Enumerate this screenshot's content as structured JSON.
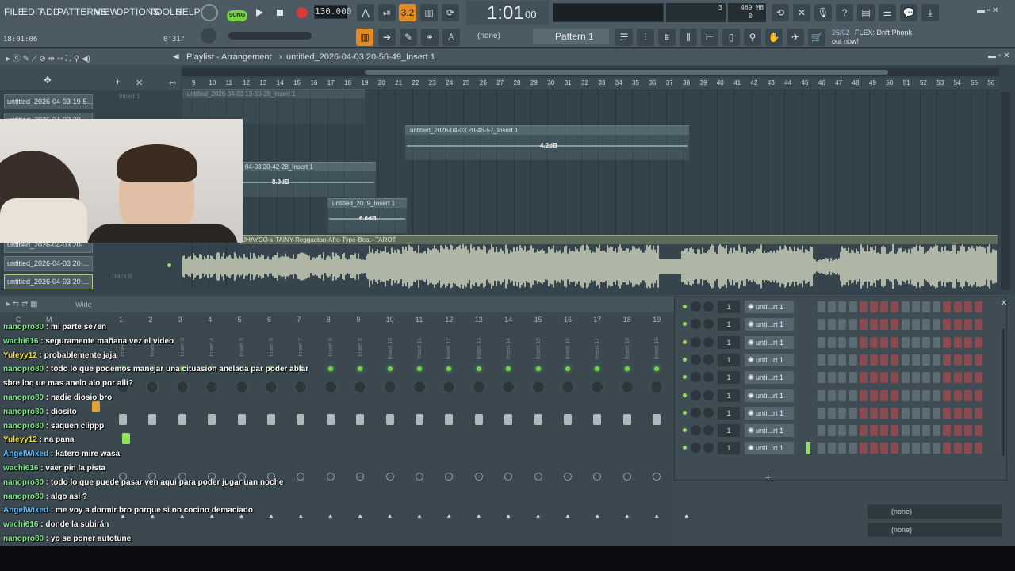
{
  "menu": [
    "FILE",
    "EDIT",
    "ADD",
    "PATTERNS",
    "VIEW",
    "OPTIONS",
    "TOOLS",
    "HELP"
  ],
  "transport": {
    "song_label": "SONG",
    "tempo": "130.000",
    "time": "1:01",
    "time_small": "00",
    "pattern_none": "(none)",
    "pattern": "Pattern 1",
    "cpu_top": "3",
    "mem": "469 MB",
    "mem_sub": "0",
    "hint_date": "26/02",
    "hint_text": "FLEX: Drift Phonk",
    "hint_sub": "out now!"
  },
  "status": {
    "time_left": "18:01:06",
    "duration": "0'31\""
  },
  "playlist": {
    "title": "Playlist - Arrangement",
    "breadcrumb": "untitled_2026-04-03 20-56-49_Insert 1",
    "ruler": [
      "9",
      "10",
      "11",
      "12",
      "13",
      "14",
      "15",
      "16",
      "17",
      "18",
      "19",
      "20",
      "21",
      "22",
      "23",
      "24",
      "25",
      "26",
      "27",
      "28",
      "29",
      "30",
      "31",
      "32",
      "33",
      "34",
      "35",
      "36",
      "37",
      "38",
      "39",
      "40",
      "41",
      "42",
      "43",
      "44",
      "45",
      "46",
      "47",
      "48",
      "49",
      "50",
      "51",
      "52",
      "53",
      "54",
      "55",
      "56"
    ],
    "tracks": [
      "untitled_2026-04-03 19-5...",
      "untitled_2026-04-03 20-...",
      "untitled_2026-04-03 20-...",
      "untitled_2026-04-03 20-...",
      "untitled_2026-04-03 20-..."
    ],
    "lane_labels": [
      "Insert 1",
      "Track 6"
    ],
    "clips": [
      {
        "label": "untitled_2026-04-03 19-59-28_Insert 1",
        "vol": ""
      },
      {
        "label": "untitled_2026-04-03 20-45-57_Insert 1",
        "vol": "4.2dB"
      },
      {
        "label": "04-03 20-42-28_Insert 1",
        "vol": "8.9dB"
      },
      {
        "label": "untitled_20..9_Insert 1",
        "vol": "6.6dB"
      },
      {
        "label": "JHAYCO-x-TAINY-Reggaeton-Afro-Type-Beat--TAROT",
        "vol": ""
      }
    ]
  },
  "mixer": {
    "wide_label": "Wide",
    "channel_header": [
      "C",
      "M",
      "1",
      "2",
      "3",
      "4",
      "5",
      "6",
      "7",
      "8",
      "9",
      "10",
      "11",
      "12",
      "13",
      "14",
      "15",
      "16",
      "17",
      "18",
      "19",
      "20"
    ],
    "strip_labels": [
      "Insert 1",
      "Insert 2",
      "Insert 3",
      "Insert 4",
      "Insert 5",
      "Insert 6",
      "Insert 7",
      "Insert 8",
      "Insert 9",
      "Insert 10",
      "Insert 11",
      "Insert 12",
      "Insert 13",
      "Insert 14",
      "Insert 15",
      "Insert 16",
      "Insert 17",
      "Insert 18",
      "Insert 19",
      "Insert 20"
    ]
  },
  "chat": [
    {
      "user": "nanopro80",
      "text": "mi parte se7en",
      "color": "#7ee787"
    },
    {
      "user": "wachi616",
      "text": "seguramente mañana vez el video",
      "color": "#7ee787"
    },
    {
      "user": "Yuleyy12",
      "text": "probablemente jaja",
      "color": "#f0e14a"
    },
    {
      "user": "nanopro80",
      "text": "todo lo que podemos manejar una cituasion anelada par poder ablar",
      "color": "#7ee787"
    },
    {
      "user": "",
      "text": "sbre loq ue mas anelo alo por alli?",
      "color": "#7ee787"
    },
    {
      "user": "nanopro80",
      "text": "nadie diosio bro",
      "color": "#7ee787"
    },
    {
      "user": "nanopro80",
      "text": "diosito",
      "color": "#7ee787"
    },
    {
      "user": "nanopro80",
      "text": "saquen clippp",
      "color": "#7ee787"
    },
    {
      "user": "Yuleyy12",
      "text": "na pana",
      "color": "#f0e14a"
    },
    {
      "user": "AngelWixed",
      "text": "katero mire wasa",
      "color": "#5bb8ff"
    },
    {
      "user": "wachi616",
      "text": "vaer pin la pista",
      "color": "#7ee787"
    },
    {
      "user": "nanopro80",
      "text": "todo lo que puede pasar ven aqui para poder jugar uan noche",
      "color": "#7ee787"
    },
    {
      "user": "nanopro80",
      "text": "algo asi ?",
      "color": "#7ee787"
    },
    {
      "user": "AngelWixed",
      "text": "me voy a dormir bro porque si no cocino demaciado",
      "color": "#5bb8ff"
    },
    {
      "user": "wachi616",
      "text": "donde la subirán",
      "color": "#7ee787"
    },
    {
      "user": "nanopro80",
      "text": "yo se poner autotune",
      "color": "#7ee787"
    }
  ],
  "rack": {
    "channels": [
      {
        "num": "1",
        "name": "unti...rt 1"
      },
      {
        "num": "1",
        "name": "unti...rt 1"
      },
      {
        "num": "1",
        "name": "unti...rt 1"
      },
      {
        "num": "1",
        "name": "unti...rt 1"
      },
      {
        "num": "1",
        "name": "unti...rt 1"
      },
      {
        "num": "1",
        "name": "unti...rt 1"
      },
      {
        "num": "1",
        "name": "unti...rt 1"
      },
      {
        "num": "1",
        "name": "unti...rt 1"
      },
      {
        "num": "1",
        "name": "unti...rt 1"
      }
    ],
    "add_label": "+",
    "none_1": "(none)",
    "none_2": "(none)"
  }
}
